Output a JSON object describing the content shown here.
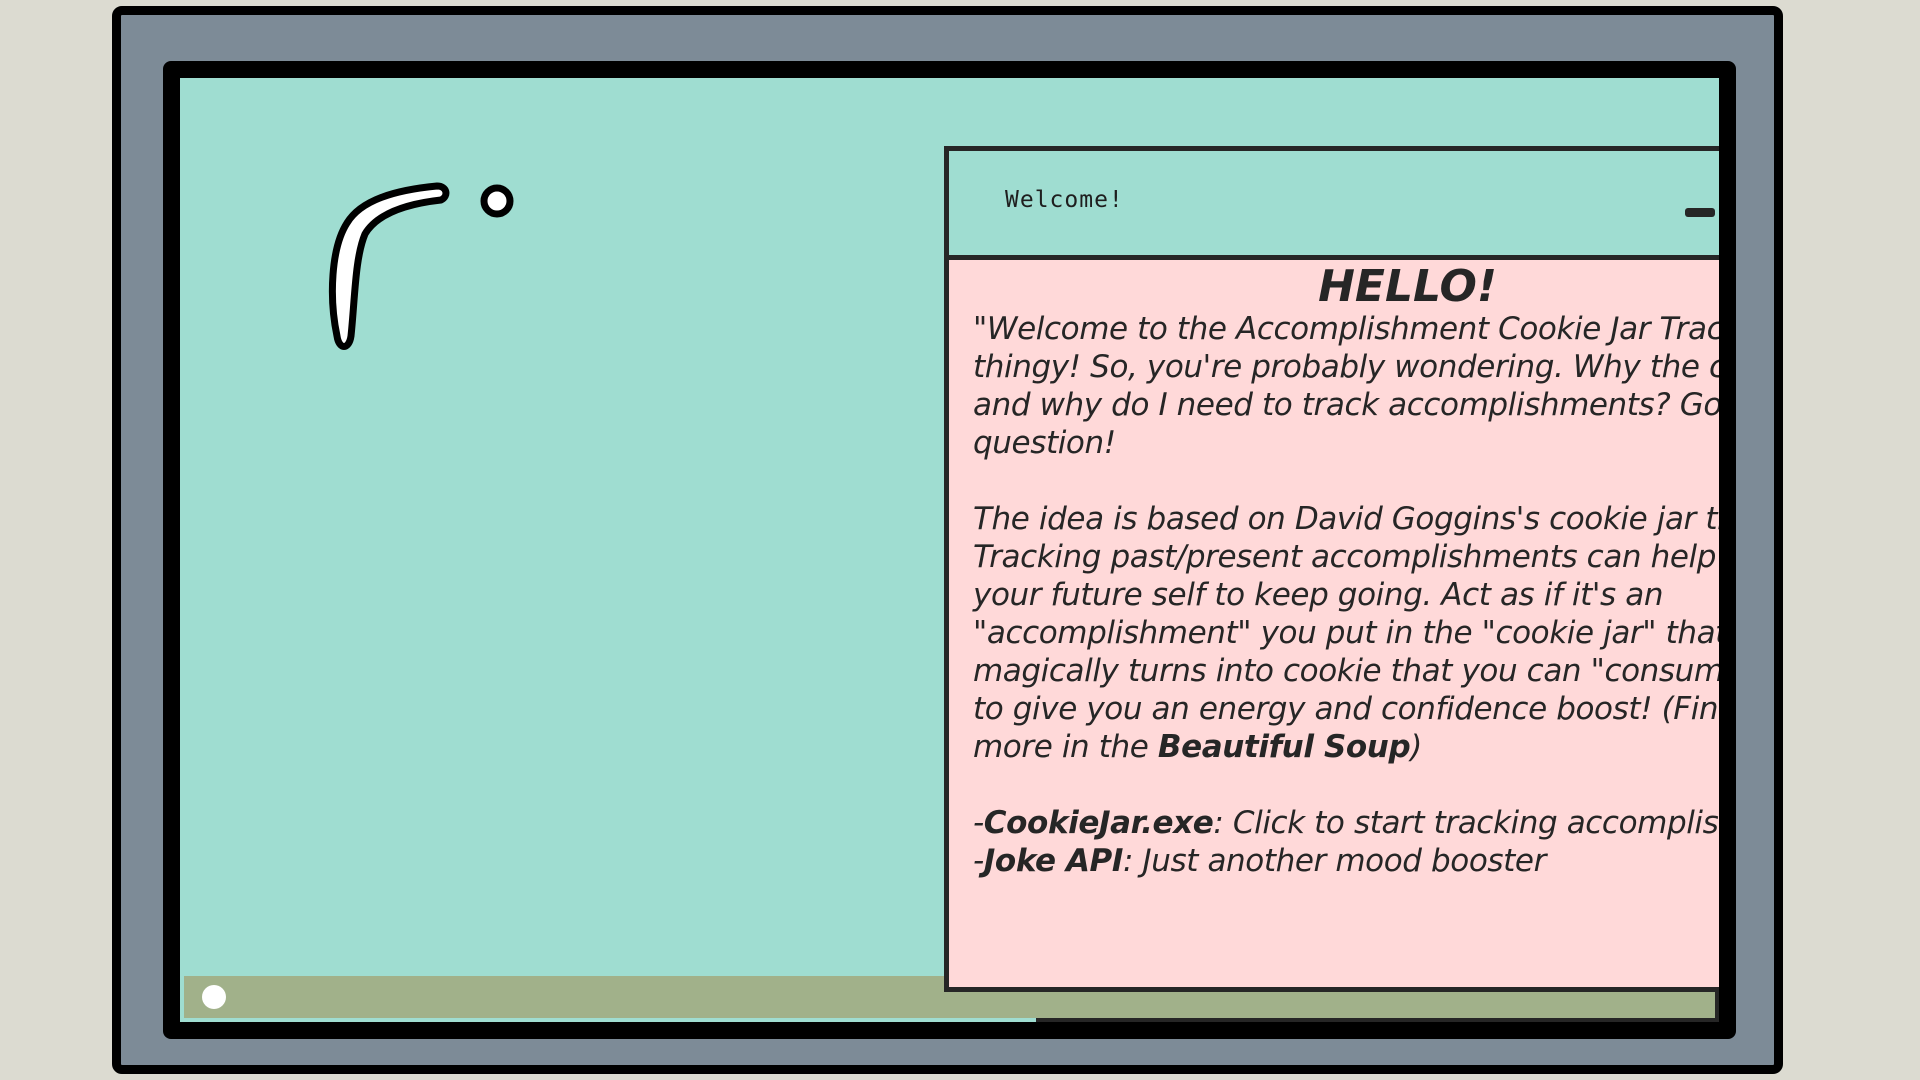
{
  "window": {
    "title": "Welcome!",
    "heading": "HELLO!",
    "intro": "\"Welcome to the Accomplishment Cookie Jar Tracker thingy! So, you're probably wondering. Why the cookie jar and why do I need to track accomplishments? Good question!",
    "theory_text": "The idea is based on David Goggins's cookie jar theory. Tracking past/present accomplishments can help motivate your future self to keep going. Act as if it's an \"accomplishment\" you put in the \"cookie jar\" that magically turns into cookie that you can \"consume\" later to give you an energy and confidence boost! (Find out more in the ",
    "theory_link": "Beautiful Soup",
    "theory_end": ")",
    "items": [
      {
        "prefix": "-",
        "name": "CookieJar.exe",
        "desc": ": Click to start tracking accomplishments!"
      },
      {
        "prefix": "-",
        "name": "Joke API",
        "desc": ": Just another mood booster"
      }
    ]
  },
  "icons": {
    "minimize": "minimize-icon",
    "maximize": "restore-icon",
    "close": "close-icon",
    "start": "start-dot-icon"
  },
  "colors": {
    "desktop": "#9fddd1",
    "window_body": "#ffd9d9",
    "taskbar": "#a1b18a",
    "bezel": "#7d8b97",
    "ink": "#262626"
  }
}
